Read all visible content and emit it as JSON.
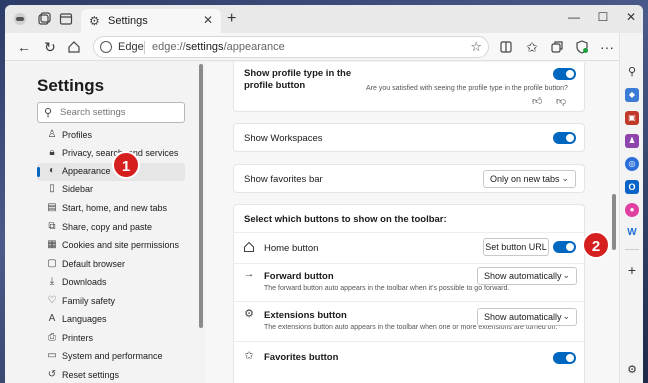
{
  "browser": {
    "tab_title": "Settings",
    "address_label": "Edge",
    "url_prefix": "edge://",
    "url_path": "settings",
    "url_suffix": "/appearance"
  },
  "settings_nav": {
    "title": "Settings",
    "search_placeholder": "Search settings",
    "items": [
      {
        "label": "Profiles",
        "icon": "profile-icon"
      },
      {
        "label": "Privacy, search, and services",
        "icon": "lock-icon"
      },
      {
        "label": "Appearance",
        "icon": "appearance-icon",
        "active": true
      },
      {
        "label": "Sidebar",
        "icon": "sidebar-icon"
      },
      {
        "label": "Start, home, and new tabs",
        "icon": "start-icon"
      },
      {
        "label": "Share, copy and paste",
        "icon": "share-icon"
      },
      {
        "label": "Cookies and site permissions",
        "icon": "cookies-icon"
      },
      {
        "label": "Default browser",
        "icon": "browser-icon"
      },
      {
        "label": "Downloads",
        "icon": "download-icon"
      },
      {
        "label": "Family safety",
        "icon": "family-icon"
      },
      {
        "label": "Languages",
        "icon": "languages-icon"
      },
      {
        "label": "Printers",
        "icon": "printer-icon"
      },
      {
        "label": "System and performance",
        "icon": "system-icon"
      },
      {
        "label": "Reset settings",
        "icon": "reset-icon"
      }
    ]
  },
  "content": {
    "profile_type": {
      "label_line1": "Show profile type in the",
      "label_line2": "profile button",
      "feedback_question": "Are you satisfied with seeing the profile type in the profile button?"
    },
    "workspaces": {
      "label": "Show Workspaces"
    },
    "favorites_bar": {
      "label": "Show favorites bar",
      "value": "Only on new tabs"
    },
    "toolbar_section": {
      "heading": "Select which buttons to show on the toolbar:",
      "home": {
        "label": "Home button",
        "button": "Set button URL"
      },
      "forward": {
        "label": "Forward button",
        "value": "Show automatically",
        "sub": "The forward button auto appears in the toolbar when it's possible to go forward."
      },
      "extensions": {
        "label": "Extensions button",
        "value": "Show automatically",
        "sub": "The extensions button auto appears in the toolbar when one or more extensions are turned on."
      },
      "favorites": {
        "label": "Favorites button"
      }
    }
  },
  "markers": {
    "one": "1",
    "two": "2"
  },
  "colors": {
    "accent": "#0067c0",
    "marker": "#d62020"
  }
}
